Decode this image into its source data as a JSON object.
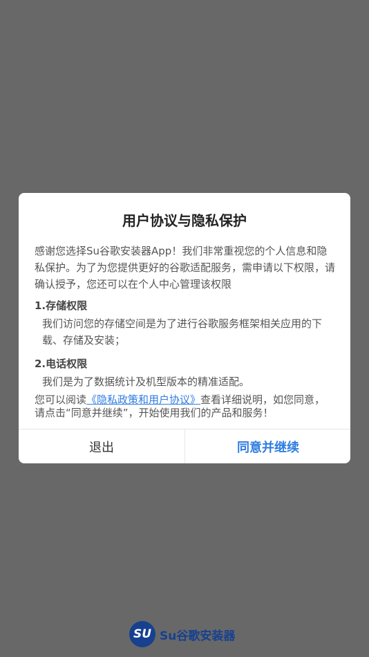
{
  "dialog": {
    "title": "用户协议与隐私保护",
    "intro": "感谢您选择Su谷歌安装器App！我们非常重视您的个人信息和隐私保护。为了为您提供更好的谷歌适配服务，需申请以下权限，请确认授予，您还可以在个人中心管理该权限",
    "permissions": [
      {
        "heading": "1.存储权限",
        "description": "我们访问您的存储空间是为了进行谷歌服务框架相关应用的下载、存储及安装；"
      },
      {
        "heading": "2.电话权限",
        "description": "我们是为了数据统计及机型版本的精准适配。"
      }
    ],
    "footer_prefix": "您可以阅读",
    "footer_link": "《隐私政策和用户协议》",
    "footer_suffix": "查看详细说明，如您同意，请点击“同意并继续”，开始使用我们的产品和服务！",
    "exit_label": "退出",
    "agree_label": "同意并继续"
  },
  "brand": {
    "logo_text": "SU",
    "name": "Su谷歌安装器"
  }
}
